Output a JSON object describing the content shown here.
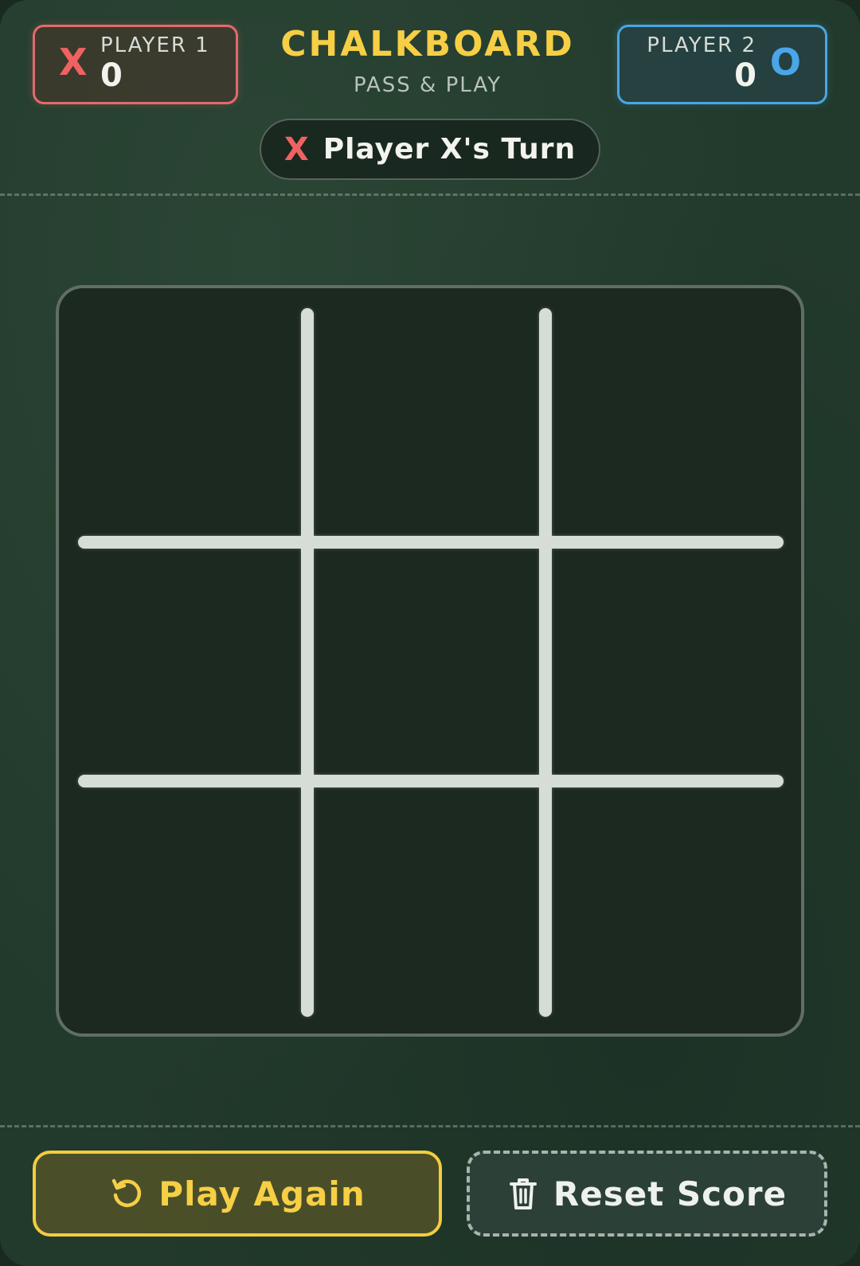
{
  "header": {
    "title": "CHALKBOARD",
    "subtitle": "PASS & PLAY"
  },
  "player1": {
    "label": "PLAYER 1",
    "mark": "X",
    "score": "0",
    "color": "#e46a6a"
  },
  "player2": {
    "label": "PLAYER 2",
    "mark": "O",
    "score": "0",
    "color": "#4aa6e4"
  },
  "turn": {
    "mark": "X",
    "text": "Player X's Turn"
  },
  "board": {
    "cells": [
      "",
      "",
      "",
      "",
      "",
      "",
      "",
      "",
      ""
    ]
  },
  "actions": {
    "play_again_label": "Play Again",
    "play_again_icon": "restart-icon",
    "reset_score_label": "Reset Score",
    "reset_score_icon": "trash-icon"
  },
  "colors": {
    "accent": "#f6cf45",
    "chalk": "#d6ddd6",
    "board_bg": "#1c2920",
    "background": "#223a2c"
  }
}
